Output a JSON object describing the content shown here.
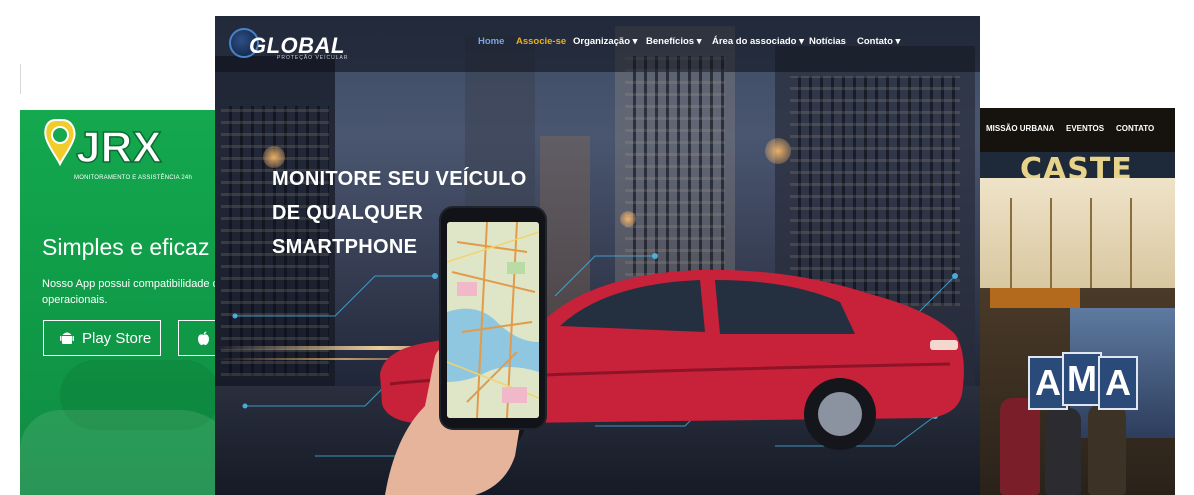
{
  "left_site": {
    "logo_text": "JRX",
    "logo_tagline": "MONITORAMENTO E ASSISTÊNCIA 24h",
    "heading": "Simples e eficaz",
    "body_text": "Nosso App possui compatibilidade com operacionais.",
    "buttons": [
      {
        "label": "Play Store",
        "icon": "android-icon"
      },
      {
        "label": "",
        "icon": "apple-icon"
      }
    ],
    "brand_color": "#14a84f"
  },
  "center_site": {
    "logo_text": "GLOBAL",
    "logo_subtitle": "PROTEÇÃO VEICULAR",
    "nav": [
      {
        "label": "Home",
        "dropdown": false
      },
      {
        "label": "Associe-se",
        "dropdown": false
      },
      {
        "label": "Organização",
        "dropdown": true
      },
      {
        "label": "Benefícios",
        "dropdown": true
      },
      {
        "label": "Área do associado",
        "dropdown": true
      },
      {
        "label": "Notícias",
        "dropdown": false
      },
      {
        "label": "Contato",
        "dropdown": true
      }
    ],
    "hero_lines": [
      "MONITORE SEU VEÍCULO",
      "DE QUALQUER",
      "SMARTPHONE"
    ],
    "accent_color": "#e8b020",
    "home_color": "#7aa6e0",
    "car_color": "#c8213a"
  },
  "right_site": {
    "nav": [
      "MISSÃO URBANA",
      "EVENTOS",
      "CONTATO"
    ],
    "sign_text": "CASTE",
    "board_letters": [
      "A",
      "M",
      "A"
    ]
  }
}
